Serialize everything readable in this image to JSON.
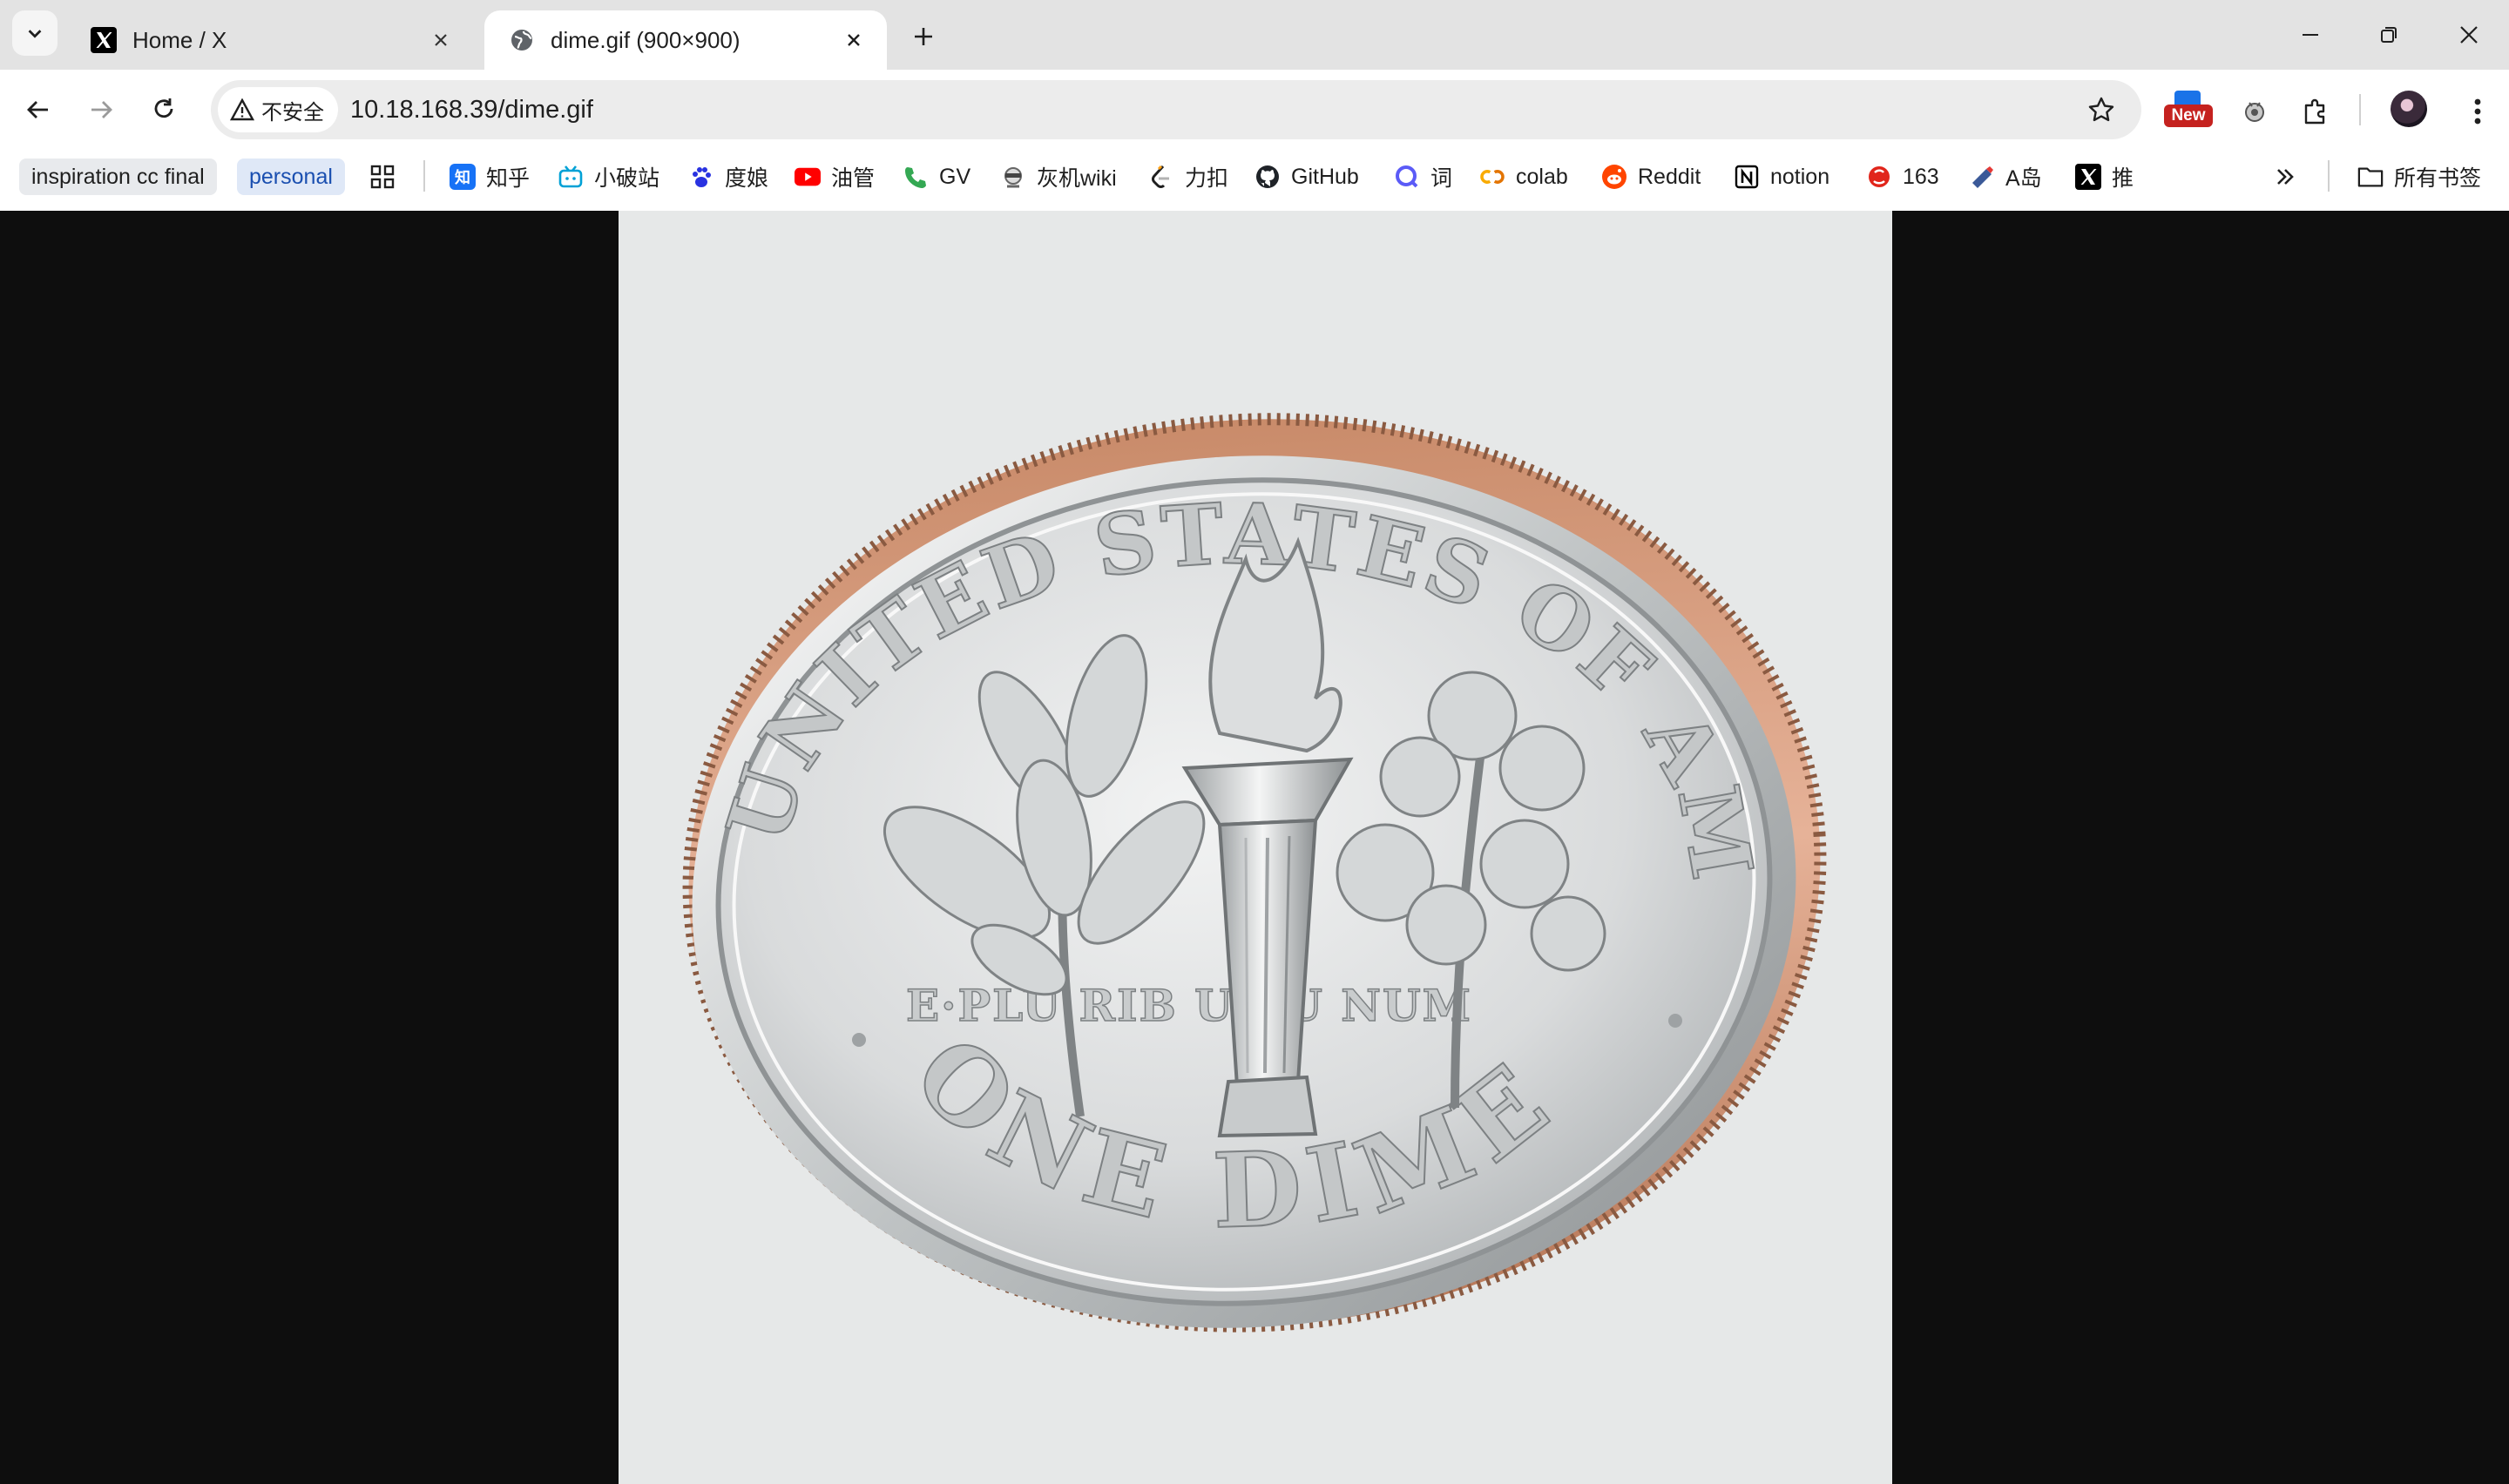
{
  "tabs": [
    {
      "title": "Home / X",
      "icon": "x-logo-icon",
      "active": false
    },
    {
      "title": "dime.gif (900×900)",
      "icon": "globe-icon",
      "active": true
    }
  ],
  "toolbar": {
    "security_label": "不安全",
    "url": "10.18.168.39/dime.gif",
    "extension_badge": "New"
  },
  "bookmarks": [
    {
      "label": "inspiration cc final",
      "style": "pill"
    },
    {
      "label": "personal",
      "style": "pill-blue"
    },
    {
      "label": "知乎",
      "icon": "zhihu-icon",
      "color": "#1772f6",
      "glyph": "知"
    },
    {
      "label": "小破站",
      "icon": "bilibili-icon",
      "color": "#00a1d6"
    },
    {
      "label": "度娘",
      "icon": "baidu-paw-icon",
      "color": "#2932e1"
    },
    {
      "label": "油管",
      "icon": "youtube-icon",
      "color": "#ff0000"
    },
    {
      "label": "GV",
      "icon": "phone-icon",
      "color": "#34a853"
    },
    {
      "label": "灰机wiki",
      "icon": "wiki-mascot-icon",
      "color": "#777777"
    },
    {
      "label": "力扣",
      "icon": "leetcode-icon",
      "color": "#ffa116"
    },
    {
      "label": "GitHub",
      "icon": "github-icon",
      "color": "#1f2328"
    },
    {
      "label": "词",
      "icon": "search-q-icon",
      "color": "#5b5bf7"
    },
    {
      "label": "colab",
      "icon": "colab-icon",
      "color": "#f9ab00"
    },
    {
      "label": "Reddit",
      "icon": "reddit-icon",
      "color": "#ff4500"
    },
    {
      "label": "notion",
      "icon": "notion-icon",
      "color": "#000000"
    },
    {
      "label": "163",
      "icon": "netease-icon",
      "color": "#e1251b"
    },
    {
      "label": "A岛",
      "icon": "a-island-icon",
      "color": "#3b5998"
    },
    {
      "label": "推",
      "icon": "x-logo-icon",
      "color": "#000000"
    }
  ],
  "all_bookmarks_label": "所有书签",
  "image": {
    "description_icon": "dime-coin-image",
    "legend_top": "UNITED STATES OF AMERICA",
    "motto": "E·PLU RIB US·U NUM",
    "legend_bottom": "ONE DIME"
  },
  "colors": {
    "tabstrip": "#e3e3e3",
    "toolbar": "#ffffff",
    "viewport_bg": "#0e0e0e",
    "image_bg": "#e6e8e8"
  }
}
